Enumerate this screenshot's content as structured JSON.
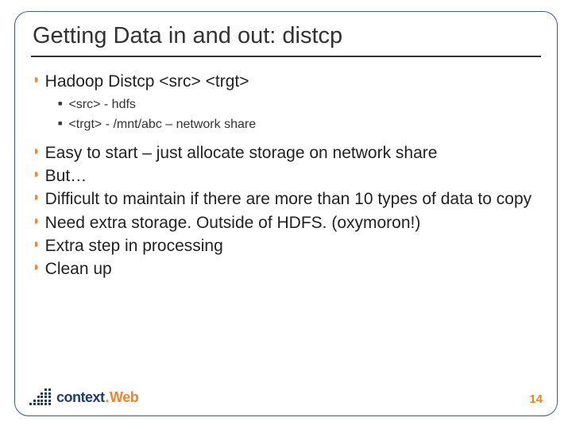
{
  "title": "Getting Data in and out: distcp",
  "bullets": {
    "b0": "Hadoop Distcp <src> <trgt>",
    "b0_sub": {
      "s0": "<src> - hdfs",
      "s1": "<trgt> - /mnt/abc – network share"
    },
    "b1": "Easy to start – just allocate storage on network share",
    "b2": "But…",
    "b3": "Difficult to maintain if there are more than 10 types of data to copy",
    "b4": "Need extra storage. Outside of HDFS. (oxymoron!)",
    "b5": "Extra step in processing",
    "b6": "Clean up"
  },
  "logo": {
    "part1": "context",
    "dot": ".",
    "part2": "Web"
  },
  "page_number": "14"
}
